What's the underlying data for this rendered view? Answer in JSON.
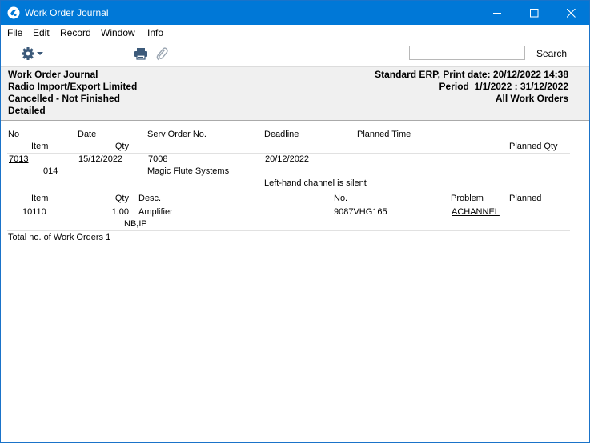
{
  "window": {
    "title": "Work Order Journal"
  },
  "menu": [
    "File",
    "Edit",
    "Record",
    "Window",
    "Info"
  ],
  "toolbar": {
    "search_value": "",
    "search_label": "Search"
  },
  "report_header": {
    "left": [
      "Work Order Journal",
      "Radio Import/Export Limited",
      "Cancelled - Not Finished",
      "Detailed"
    ],
    "right": [
      "Standard ERP, Print date: 20/12/2022 14:38",
      "Period  1/1/2022 : 31/12/2022",
      "All Work Orders"
    ]
  },
  "columns": {
    "no": "No",
    "date": "Date",
    "serv_order": "Serv Order No.",
    "deadline": "Deadline",
    "planned_time": "Planned Time",
    "item": "Item",
    "qty": "Qty",
    "planned_qty": "Planned Qty"
  },
  "work_order": {
    "no": "7013",
    "date": "15/12/2022",
    "serv_order": "7008",
    "deadline": "20/12/2022",
    "item": "014",
    "customer": "Magic Flute Systems",
    "comment": "Left-hand channel is silent"
  },
  "item_columns": {
    "item": "Item",
    "qty": "Qty",
    "desc": "Desc.",
    "no": "No.",
    "problem": "Problem",
    "planned": "Planned"
  },
  "item_row": {
    "item": "10110",
    "qty": "1.00",
    "desc": "Amplifier",
    "no": "9087VHG165",
    "problem": "ACHANNEL",
    "extra": "NB,IP"
  },
  "footer": {
    "total": "Total no. of Work Orders 1"
  }
}
